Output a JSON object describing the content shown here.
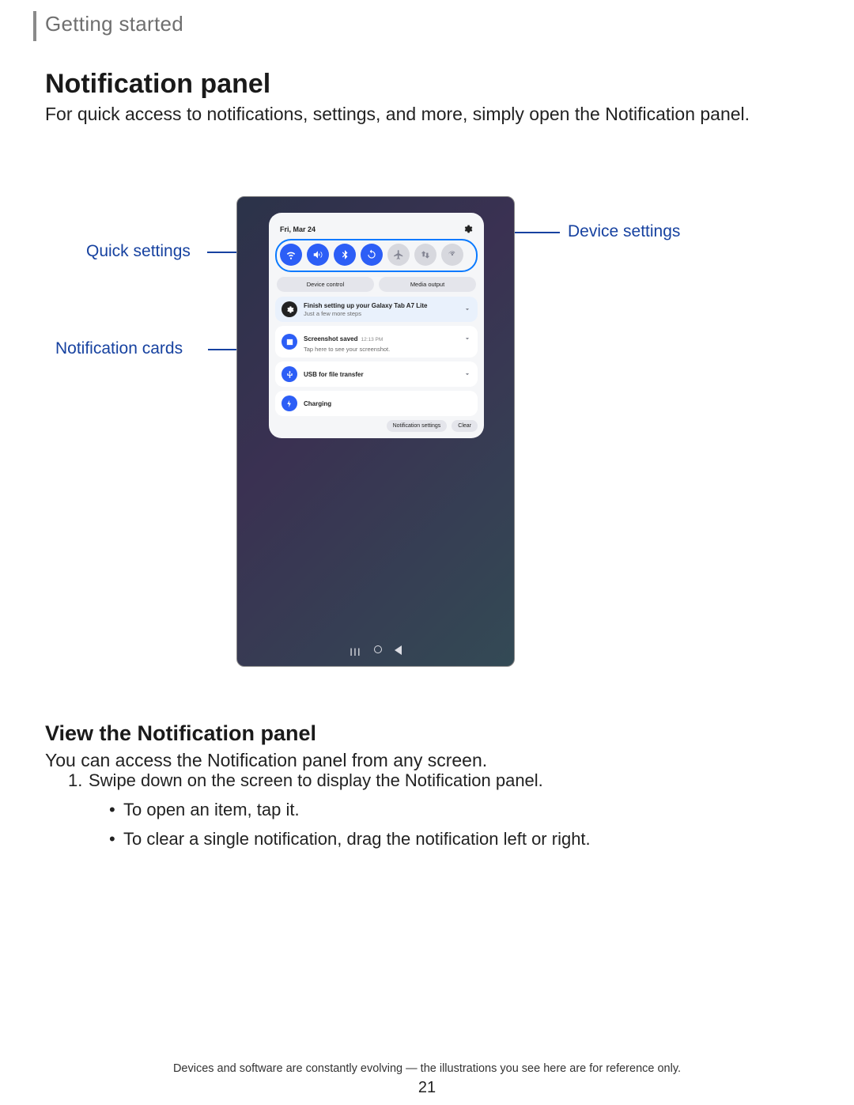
{
  "section": "Getting started",
  "h1": "Notification panel",
  "intro": "For quick access to notifications, settings, and more, simply open the Notification panel.",
  "callouts": {
    "quick_settings": "Quick settings",
    "device_settings": "Device settings",
    "notification_cards": "Notification cards"
  },
  "device": {
    "date": "Fri, Mar 24",
    "qs": [
      {
        "name": "wifi",
        "on": true
      },
      {
        "name": "sound",
        "on": true
      },
      {
        "name": "bluetooth",
        "on": true
      },
      {
        "name": "rotate",
        "on": true
      },
      {
        "name": "airplane",
        "on": false
      },
      {
        "name": "data",
        "on": false
      },
      {
        "name": "hotspot",
        "on": false
      }
    ],
    "buttons": {
      "device_control": "Device control",
      "media_output": "Media output"
    },
    "notifs": [
      {
        "icon": "gear",
        "color": "#222",
        "title": "Finish setting up your Galaxy Tab A7 Lite",
        "sub": "Just a few more steps",
        "highlight": true
      },
      {
        "icon": "image",
        "color": "#2c5ef6",
        "title": "Screenshot saved",
        "time": "12:13 PM",
        "sub": "Tap here to see your screenshot."
      },
      {
        "icon": "usb",
        "color": "#2c5ef6",
        "title": "USB for file transfer",
        "sub": ""
      },
      {
        "icon": "bolt",
        "color": "#2c5ef6",
        "title": "Charging",
        "sub": ""
      }
    ],
    "bottom": {
      "settings": "Notification settings",
      "clear": "Clear"
    }
  },
  "h2": "View the Notification panel",
  "p_sub": "You can access the Notification panel from any screen.",
  "step1": "Swipe down on the screen to display the Notification panel.",
  "bul1": "To open an item, tap it.",
  "bul2": "To clear a single notification, drag the notification left or right.",
  "footer": "Devices and software are constantly evolving — the illustrations you see here are for reference only.",
  "pagenum": "21"
}
